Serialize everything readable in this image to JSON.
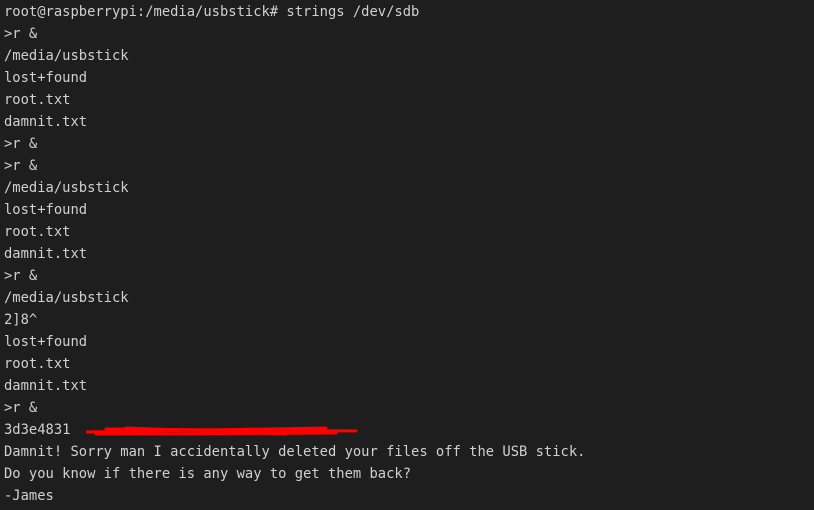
{
  "terminal": {
    "lines": [
      "root@raspberrypi:/media/usbstick# strings /dev/sdb",
      ">r &",
      "/media/usbstick",
      "lost+found",
      "root.txt",
      "damnit.txt",
      ">r &",
      ">r &",
      "/media/usbstick",
      "lost+found",
      "root.txt",
      "damnit.txt",
      ">r &",
      "/media/usbstick",
      "2]8^",
      "lost+found",
      "root.txt",
      "damnit.txt",
      ">r &",
      "3d3e4831",
      "Damnit! Sorry man I accidentally deleted your files off the USB stick.",
      "Do you know if there is any way to get them back?",
      "-James"
    ],
    "redaction_color": "#ff0000",
    "background": "#1e1e1e",
    "foreground": "#d0d0d0"
  }
}
